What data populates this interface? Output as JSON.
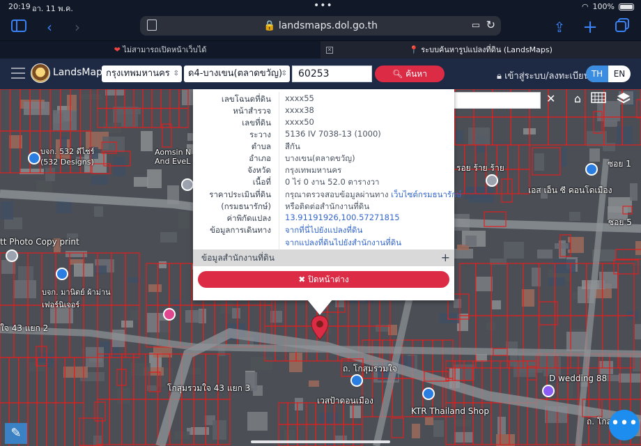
{
  "status": {
    "time": "20:19",
    "date": "อา. 11 พ.ค.",
    "battery": "100%"
  },
  "browser": {
    "url": "landsmaps.dol.go.th"
  },
  "tabs": [
    {
      "label": "ไม่สามารถเปิดหน้าเว็บได้"
    },
    {
      "label": "ระบบค้นหารูปแปลงที่ดิน (LandsMaps)"
    }
  ],
  "header": {
    "brand": "LandsMaps",
    "province": "กรุงเทพมหานคร",
    "district": "ด4-บางเขน(ตลาดขวัญ)",
    "parcel_no": "60253",
    "search_label": "ค้นหา",
    "login_label": "เข้าสู่ระบบ/ลงทะเบียน",
    "lang_th": "TH",
    "lang_en": "EN"
  },
  "map": {
    "place_search_placeholder": "ค้นหาสถานที่สำคัญ",
    "labels": [
      "บจก. 532 ดีไซร์ (532 Designs)",
      "Aomsin N And EveL",
      "รอย ร้าย ร้าย",
      "เอส เอ็น ซี คอนโดเมือง",
      "ซอย 1",
      "ซอย 5",
      "tt Photo Copy print",
      "บจก. มานิตย์ ผ้าม่าน เฟอร์นิเจอร์",
      "ใจ 43 แยก 2",
      "ถ. โกสุมรวมใจ",
      "โกสุมรวมใจ 43 แยก 3",
      "เวสป้าดอนเมือง",
      "KTR Thailand Shop",
      "D wedding 88",
      "ถ. โกสุม"
    ]
  },
  "popup": {
    "rows": [
      {
        "key": "เลขโฉนดที่ดิน",
        "value": "xxxx55"
      },
      {
        "key": "หน้าสำรวจ",
        "value": "xxxx38"
      },
      {
        "key": "เลขที่ดิน",
        "value": "xxxx50"
      },
      {
        "key": "ระวาง",
        "value": "5136 IV 7038-13 (1000)"
      },
      {
        "key": "ตำบล",
        "value": "สีกัน"
      },
      {
        "key": "อำเภอ",
        "value": "บางเขน(ตลาดขวัญ)"
      },
      {
        "key": "จังหวัด",
        "value": "กรุงเทพมหานคร"
      },
      {
        "key": "เนื้อที่",
        "value": "0 ไร่ 0 งาน 52.0 ตารางวา"
      }
    ],
    "price_key": "ราคาประเมินที่ดิน",
    "price_key2": "(กรมธนารักษ์)",
    "price_value": "กรุณาตรวจสอบข้อมูลผ่านทาง",
    "price_link": "เว็บไซต์กรมธนารักษ์",
    "price_value2": "หรือติดต่อสำนักงานที่ดิน",
    "coord_key": "ค่าพิกัดแปลง",
    "coord_value": "13.91191926,100.57271815",
    "travel_key": "ข้อมูลการเดินทาง",
    "travel_link1": "จากที่นี่ไปยังแปลงที่ดิน",
    "travel_link2": "จากแปลงที่ดินไปยังสำนักงานที่ดิน",
    "office_label": "ข้อมูลสำนักงานที่ดิน",
    "close_label": "ปิดหน้าต่าง"
  },
  "colors": {
    "accent": "#dc2b45",
    "header": "#1e2a44",
    "parcel_line": "#e0201e",
    "link": "#3366cc"
  }
}
